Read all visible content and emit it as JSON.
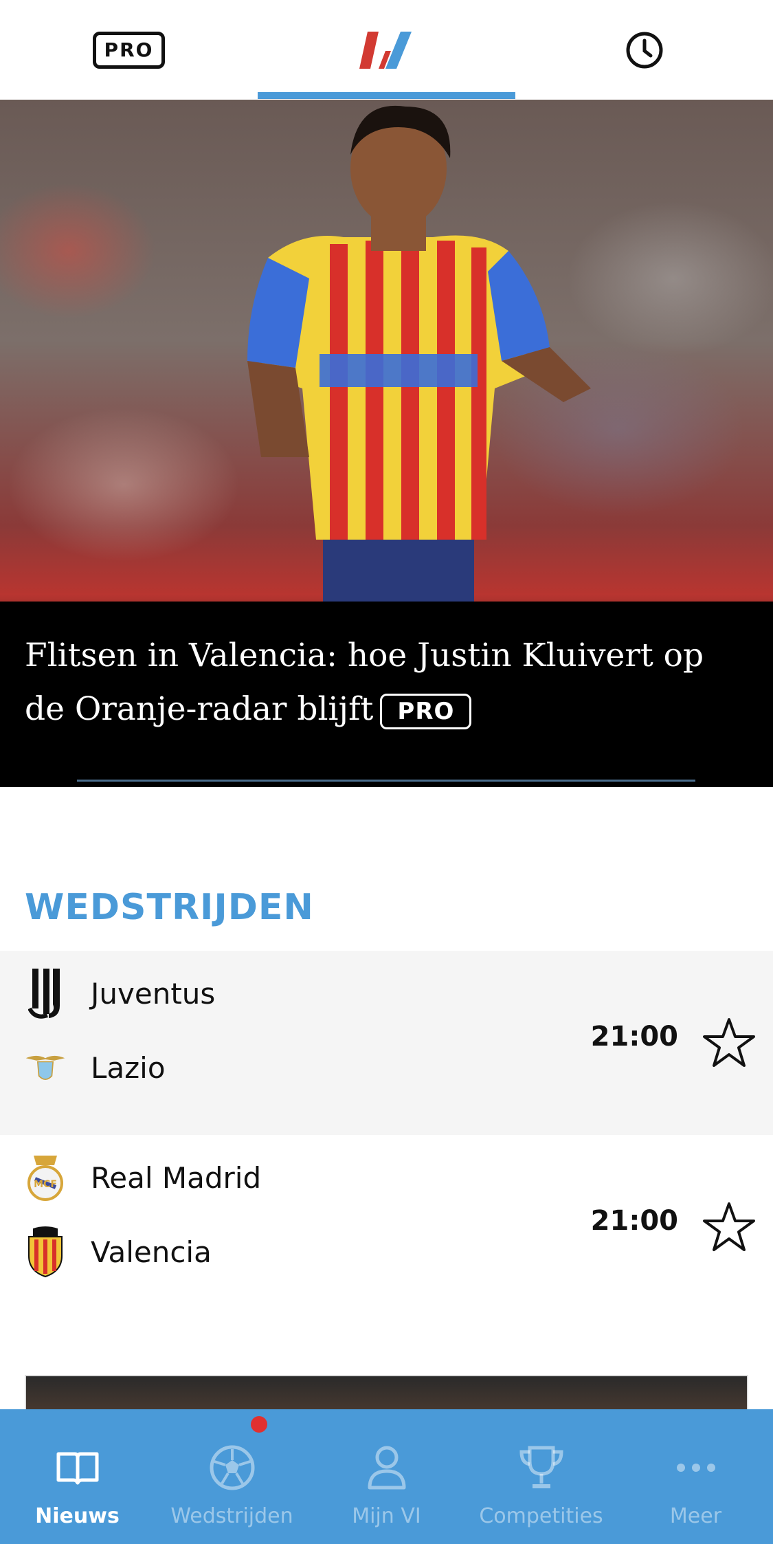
{
  "topbar": {
    "pro_label": "PRO",
    "logo_icon": "vi-logo-icon",
    "clock_icon": "clock-icon"
  },
  "hero": {
    "title": "Flitsen in Valencia: hoe Justin Kluivert op de Oranje-radar blijft",
    "pro_label": "PRO"
  },
  "section": {
    "title": "WEDSTRIJDEN"
  },
  "matches": [
    {
      "home": "Juventus",
      "away": "Lazio",
      "time": "21:00"
    },
    {
      "home": "Real Madrid",
      "away": "Valencia",
      "time": "21:00"
    }
  ],
  "bottom_nav": [
    {
      "label": "Nieuws",
      "icon": "book-icon",
      "active": true
    },
    {
      "label": "Wedstrijden",
      "icon": "soccer-ball-icon",
      "active": false
    },
    {
      "label": "Mijn VI",
      "icon": "person-icon",
      "active": false
    },
    {
      "label": "Competities",
      "icon": "trophy-icon",
      "active": false
    },
    {
      "label": "Meer",
      "icon": "more-dots-icon",
      "active": false
    }
  ],
  "colors": {
    "accent": "#4a9ad8",
    "brand_red": "#d23a32",
    "notification": "#e03030"
  }
}
